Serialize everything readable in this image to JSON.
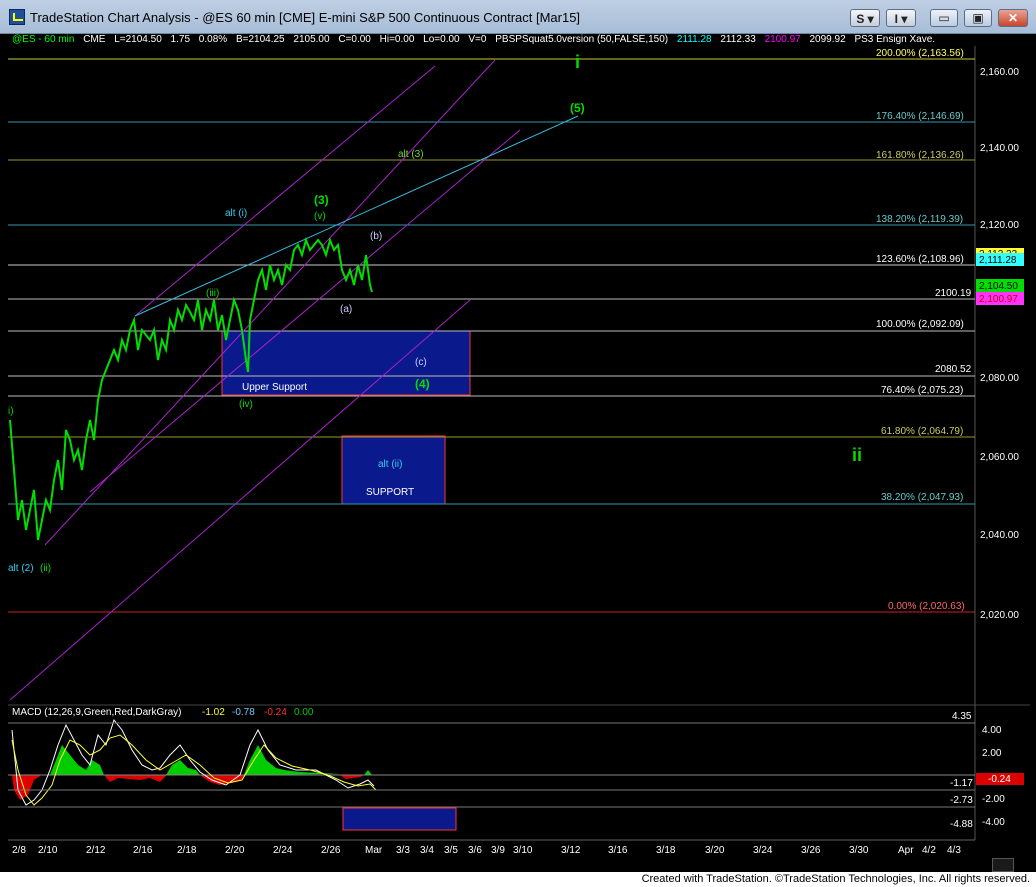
{
  "window": {
    "title": "TradeStation Chart Analysis - @ES 60 min [CME] E-mini S&P 500 Continuous Contract [Mar15]",
    "btn_s": "S",
    "btn_i": "I",
    "btn_min": "▭",
    "btn_max": "▣",
    "btn_close": "✕"
  },
  "legend": {
    "symbol": "@ES - 60 min",
    "exchange": "CME",
    "last": "L=2104.50",
    "change": "1.75",
    "pct": "0.08%",
    "bid": "B=2104.25",
    "ask": "2105.00",
    "c": "C=0.00",
    "hi": "Hi=0.00",
    "lo": "Lo=0.00",
    "v": "V=0",
    "indicator": "PBSPSquat5.0version (50,FALSE,150)",
    "ind_v1": "2111.28",
    "ind_v2": "2112.33",
    "ind_v3": "2100.97",
    "ind_v4": "2099.92",
    "ens": "PS3 Ensign Xave.",
    "colors": {
      "green": "#00ff00",
      "cyan": "#00ffff",
      "magenta": "#ff00ff",
      "white": "#ffffff"
    }
  },
  "price_axis": [
    "2,160.00",
    "2,140.00",
    "2,120.00",
    "2,100.00",
    "2,080.00",
    "2,060.00",
    "2,040.00",
    "2,020.00"
  ],
  "fib_levels": [
    {
      "label": "200.00% (2,163.56)",
      "color": "#ffff66"
    },
    {
      "label": "176.40% (2,146.69)",
      "color": "#66cccc"
    },
    {
      "label": "161.80% (2,136.26)",
      "color": "#cccc66"
    },
    {
      "label": "138.20% (2,119.39)",
      "color": "#66cccc"
    },
    {
      "label": "123.60% (2,108.96)",
      "color": "#ffffff"
    },
    {
      "label": "100.00% (2,092.09)",
      "color": "#ffffff"
    },
    {
      "label": "76.40% (2,075.23)",
      "color": "#ffffff"
    },
    {
      "label": "61.80% (2,064.79)",
      "color": "#cccc66"
    },
    {
      "label": "38.20% (2,047.93)",
      "color": "#66cccc"
    },
    {
      "label": "0.00% (2,020.63)",
      "color": "#ff4444"
    }
  ],
  "price_lines": {
    "l1": "2100.19",
    "l2": "2080.52"
  },
  "price_tags": {
    "t1": "2,112.33",
    "t2": "2,111.28",
    "t3": "2,104.50",
    "t4": "2,100.97"
  },
  "labels": {
    "i_big": "i",
    "five": "(5)",
    "alt3": "alt (3)",
    "alti": "alt (i)",
    "three": "(3)",
    "v": "(v)",
    "b": "(b)",
    "iii": "(iii)",
    "a": "(a)",
    "c": "(c)",
    "four": "(4)",
    "upper_support": "Upper Support",
    "iv": "(iv)",
    "altii": "alt (ii)",
    "support": "SUPPORT",
    "ii_big": "ii",
    "alt2": "alt (2)",
    "ii_small": "(ii)",
    "i_left": "i)"
  },
  "macd": {
    "title": "MACD (12,26,9,Green,Red,DarkGray)",
    "v1": "-1.02",
    "v2": "-0.78",
    "v3": "-0.24",
    "v4": "0.00",
    "axis": [
      "4.00",
      "2.00",
      "-2.00",
      "-4.00"
    ],
    "levels": [
      "-1.17",
      "-2.73",
      "-4.88"
    ],
    "tag": "-0.24",
    "top_cut": "4.35"
  },
  "time_axis": [
    "2/8",
    "2/10",
    "2/12",
    "2/16",
    "2/18",
    "2/20",
    "2/24",
    "2/26",
    "Mar",
    "3/3",
    "3/4",
    "3/5",
    "3/6",
    "3/9",
    "3/10",
    "3/12",
    "3/16",
    "3/18",
    "3/20",
    "3/24",
    "3/26",
    "3/30",
    "Apr",
    "4/2",
    "4/3"
  ],
  "footer": "Created with TradeStation. ©TradeStation Technologies, Inc. All rights reserved."
}
